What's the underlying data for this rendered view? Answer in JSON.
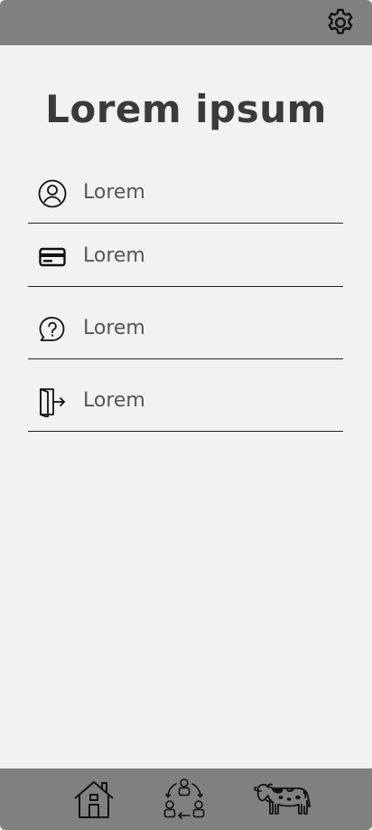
{
  "header": {
    "settings_icon": "gear-icon"
  },
  "main": {
    "title": "Lorem ipsum",
    "menu": [
      {
        "label": "Lorem",
        "icon": "user-circle-icon"
      },
      {
        "label": "Lorem",
        "icon": "credit-card-icon"
      },
      {
        "label": "Lorem",
        "icon": "help-chat-icon"
      },
      {
        "label": "Lorem",
        "icon": "logout-door-icon"
      }
    ]
  },
  "bottom_nav": {
    "items": [
      {
        "icon": "home-icon"
      },
      {
        "icon": "people-exchange-icon"
      },
      {
        "icon": "cow-icon"
      }
    ]
  },
  "colors": {
    "bars": "#808080",
    "background": "#f2f2f2",
    "title": "#3a3a3a",
    "label": "#555555"
  }
}
